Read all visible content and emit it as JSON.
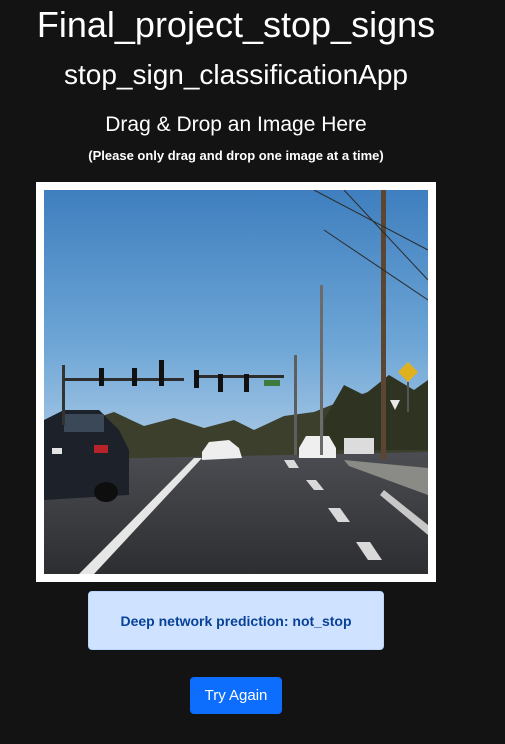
{
  "header": {
    "title": "Final_project_stop_signs",
    "subtitle": "stop_sign_classificationApp"
  },
  "upload": {
    "heading": "Drag & Drop an Image Here",
    "note": "(Please only drag and drop one image at a time)",
    "image_subject": "road-scene-photo"
  },
  "result": {
    "prediction_text": "Deep network prediction: not_stop"
  },
  "actions": {
    "try_again_label": "Try Again"
  },
  "colors": {
    "background": "#131313",
    "alert_bg": "#cfe2ff",
    "alert_text": "#084298",
    "primary_button": "#0d6efd"
  }
}
